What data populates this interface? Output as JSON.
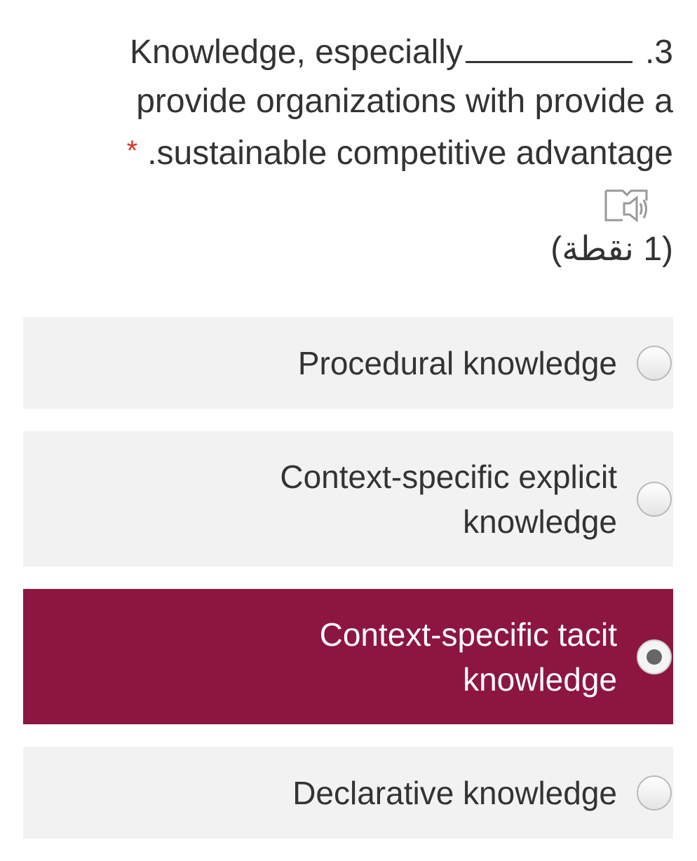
{
  "question": {
    "line1_text": "Knowledge, especially",
    "number": ".3",
    "line2": "provide organizations with provide a",
    "line3": ".sustainable competitive advantage",
    "required_marker": "*",
    "points": "(1 نقطة)"
  },
  "options": [
    {
      "label_lines": [
        "Procedural knowledge"
      ],
      "selected": false
    },
    {
      "label_lines": [
        "Context-specific explicit",
        "knowledge"
      ],
      "selected": false
    },
    {
      "label_lines": [
        "Context-specific tacit",
        "knowledge"
      ],
      "selected": true
    },
    {
      "label_lines": [
        "Declarative knowledge"
      ],
      "selected": false
    }
  ],
  "colors": {
    "selected_background": "#8c1641",
    "option_background": "#f2f2f2",
    "required_star": "#d93025"
  },
  "icons": {
    "tts": "immersive-reader-speaker-icon"
  }
}
